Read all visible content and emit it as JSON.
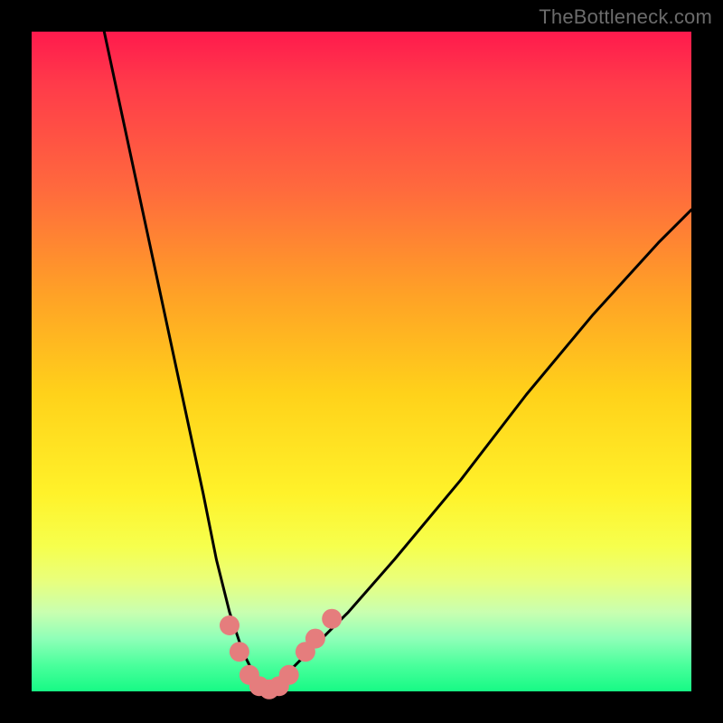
{
  "watermark": "TheBottleneck.com",
  "chart_data": {
    "type": "line",
    "title": "",
    "xlabel": "",
    "ylabel": "",
    "xlim": [
      0,
      100
    ],
    "ylim": [
      0,
      100
    ],
    "grid": false,
    "background_gradient": [
      "#ff1a4d",
      "#ff6a3d",
      "#ffd21a",
      "#f6ff4d",
      "#17fa85"
    ],
    "series": [
      {
        "name": "bottleneck-curve",
        "color": "#000000",
        "x": [
          11,
          14,
          17,
          20,
          23,
          26,
          28,
          30,
          32,
          34,
          36,
          38,
          42,
          48,
          55,
          65,
          75,
          85,
          95,
          100
        ],
        "values": [
          100,
          86,
          72,
          58,
          44,
          30,
          20,
          12,
          6,
          2,
          0,
          2,
          6,
          12,
          20,
          32,
          45,
          57,
          68,
          73
        ]
      }
    ],
    "markers": [
      {
        "name": "highlight-dots",
        "color": "#e57d7d",
        "points": [
          {
            "x": 30.0,
            "y": 10.0
          },
          {
            "x": 31.5,
            "y": 6.0
          },
          {
            "x": 33.0,
            "y": 2.5
          },
          {
            "x": 34.5,
            "y": 0.8
          },
          {
            "x": 36.0,
            "y": 0.3
          },
          {
            "x": 37.5,
            "y": 0.8
          },
          {
            "x": 39.0,
            "y": 2.5
          },
          {
            "x": 41.5,
            "y": 6.0
          },
          {
            "x": 43.0,
            "y": 8.0
          },
          {
            "x": 45.5,
            "y": 11.0
          }
        ]
      }
    ]
  }
}
